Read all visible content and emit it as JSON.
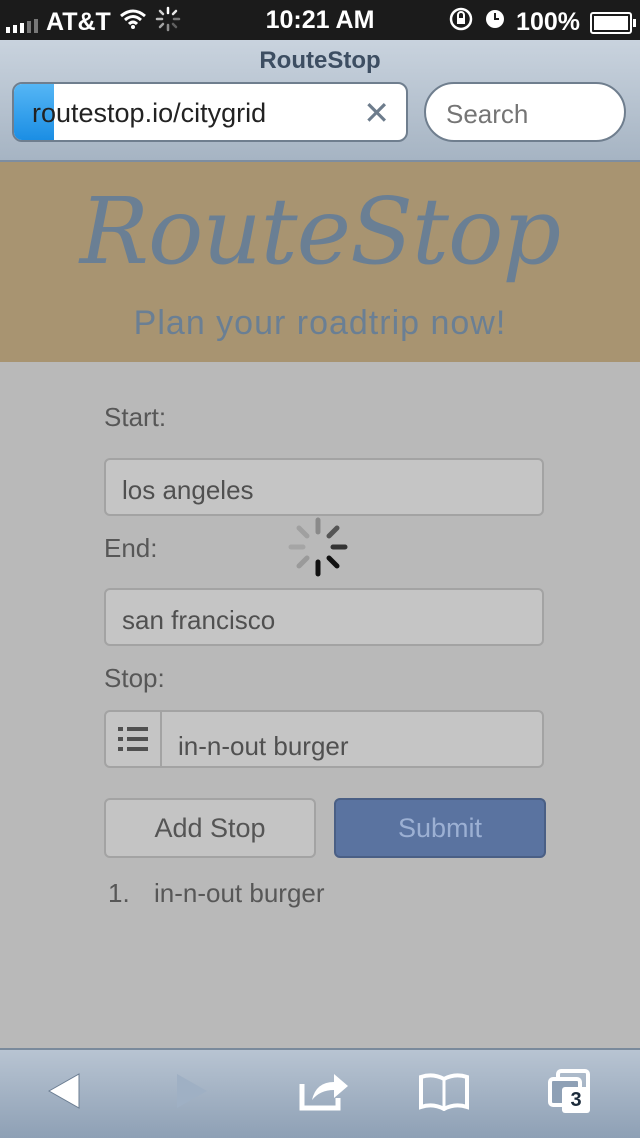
{
  "status_bar": {
    "carrier": "AT&T",
    "time": "10:21 AM",
    "battery": "100%"
  },
  "browser": {
    "title": "RouteStop",
    "url": "routestop.io/citygrid",
    "search_placeholder": "Search",
    "tab_count": "3"
  },
  "header": {
    "logo": "RouteStop",
    "tagline": "Plan your roadtrip now!"
  },
  "form": {
    "start_label": "Start:",
    "start_value": "los angeles",
    "end_label": "End:",
    "end_value": "san francisco",
    "stop_label": "Stop:",
    "stop_value": "in-n-out burger",
    "add_stop_label": "Add Stop",
    "submit_label": "Submit"
  },
  "stops": [
    {
      "number": "1.",
      "name": "in-n-out burger"
    }
  ],
  "colors": {
    "header_bg": "#a89471",
    "logo_color": "#6a7f94",
    "submit_bg": "#5a73a0"
  }
}
